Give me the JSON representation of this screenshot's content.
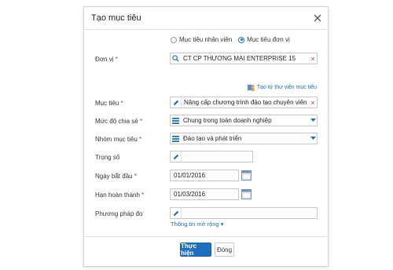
{
  "dialog": {
    "title": "Tạo mục tiêu",
    "radio": {
      "option_1": "Mục tiêu nhân viên",
      "option_2": "Mục tiêu đơn vị",
      "selected": "option_2"
    },
    "fields": {
      "unit": {
        "label": "Đơn vị",
        "value": "CT CP THƯƠNG MẠI ENTERPRISE 15"
      },
      "library_link": "Tạo từ thư viện mục tiêu",
      "objective": {
        "label": "Mục tiêu",
        "value": "Nâng cấp chương trình đào tạo chuyên viên KD"
      },
      "sharing_level": {
        "label": "Mức độ chia sẻ",
        "value": "Chung trong toàn doanh nghiệp"
      },
      "objective_group": {
        "label": "Nhóm mục tiêu",
        "value": "Đào tạo và phát triển"
      },
      "weight": {
        "label": "Trọng số",
        "value": ""
      },
      "start_date": {
        "label": "Ngày bắt đầu",
        "value": "01/01/2016"
      },
      "due_date": {
        "label": "Hạn hoàn thành",
        "value": "01/03/2016"
      },
      "method": {
        "label": "Phương pháp đo",
        "value": ""
      }
    },
    "required_mark": "*",
    "expand_link": "Thông tin mở rộng",
    "buttons": {
      "submit": "Thực hiện",
      "close": "Đóng"
    }
  },
  "colors": {
    "accent": "#1e6fbe",
    "required": "#d32f2f",
    "calendar_icon": "#7a93ad"
  }
}
